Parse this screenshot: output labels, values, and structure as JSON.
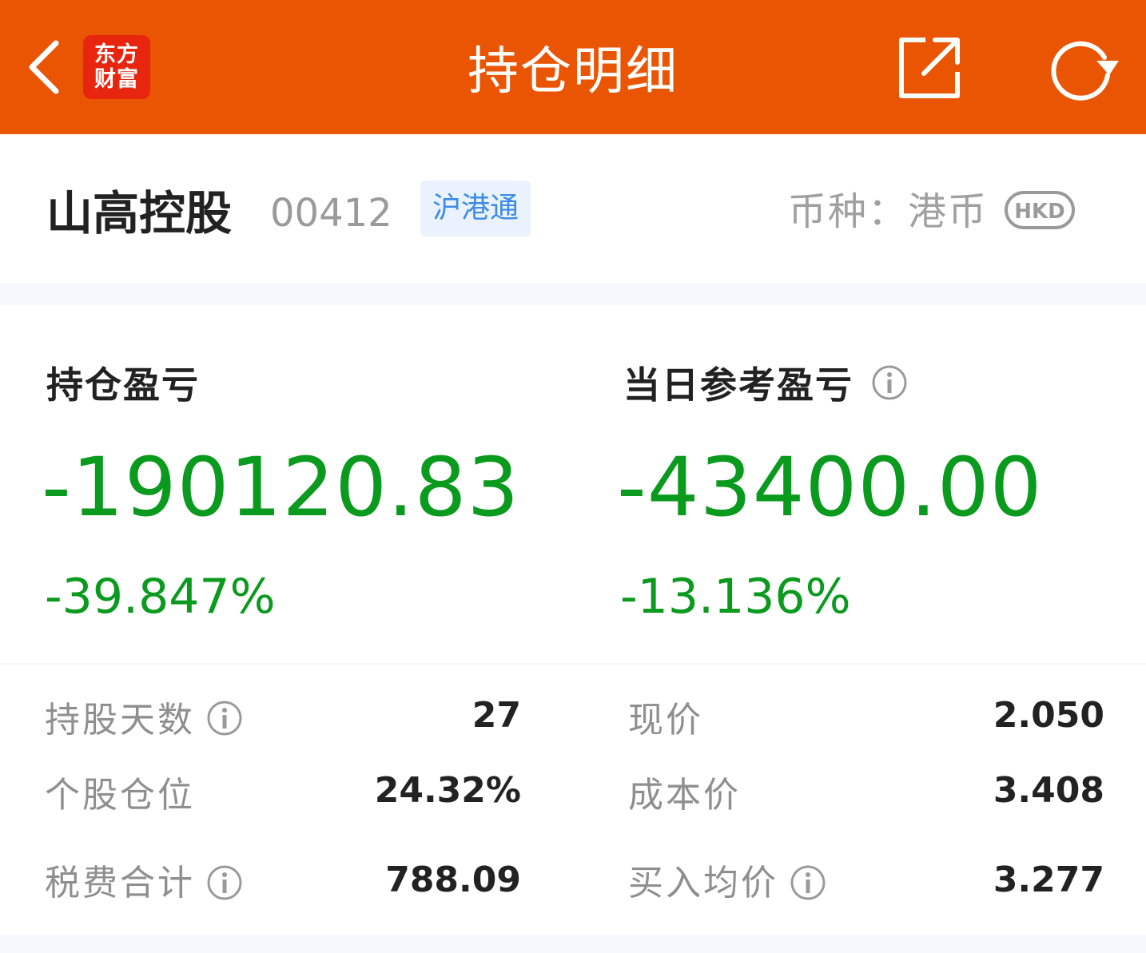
{
  "appbar": {
    "title": "持仓明细",
    "logo_line1": "东方",
    "logo_line2": "财富",
    "bg_color": "#EA5504",
    "icons": [
      "chevron-left-icon",
      "share-icon",
      "refresh-icon"
    ]
  },
  "stock": {
    "name": "山高控股",
    "code": "00412",
    "tag": "沪港通",
    "currency_label": "币种：港币",
    "currency_badge": "HKD"
  },
  "pnl": {
    "position_label": "持仓盈亏",
    "position_value": "-190120.83",
    "position_pct": "-39.847%",
    "daily_label": "当日参考盈亏",
    "daily_value": "-43400.00",
    "daily_pct": "-13.136%",
    "loss_color": "#0A9A1E"
  },
  "details": {
    "left": [
      {
        "label": "持股天数",
        "value": "27"
      },
      {
        "label": "个股仓位",
        "value": "24.32%"
      },
      {
        "label": "税费合计",
        "value": "788.09"
      }
    ],
    "right": [
      {
        "label": "现价",
        "value": "2.050"
      },
      {
        "label": "成本价",
        "value": "3.408"
      },
      {
        "label": "买入均价",
        "value": "3.277"
      }
    ]
  }
}
